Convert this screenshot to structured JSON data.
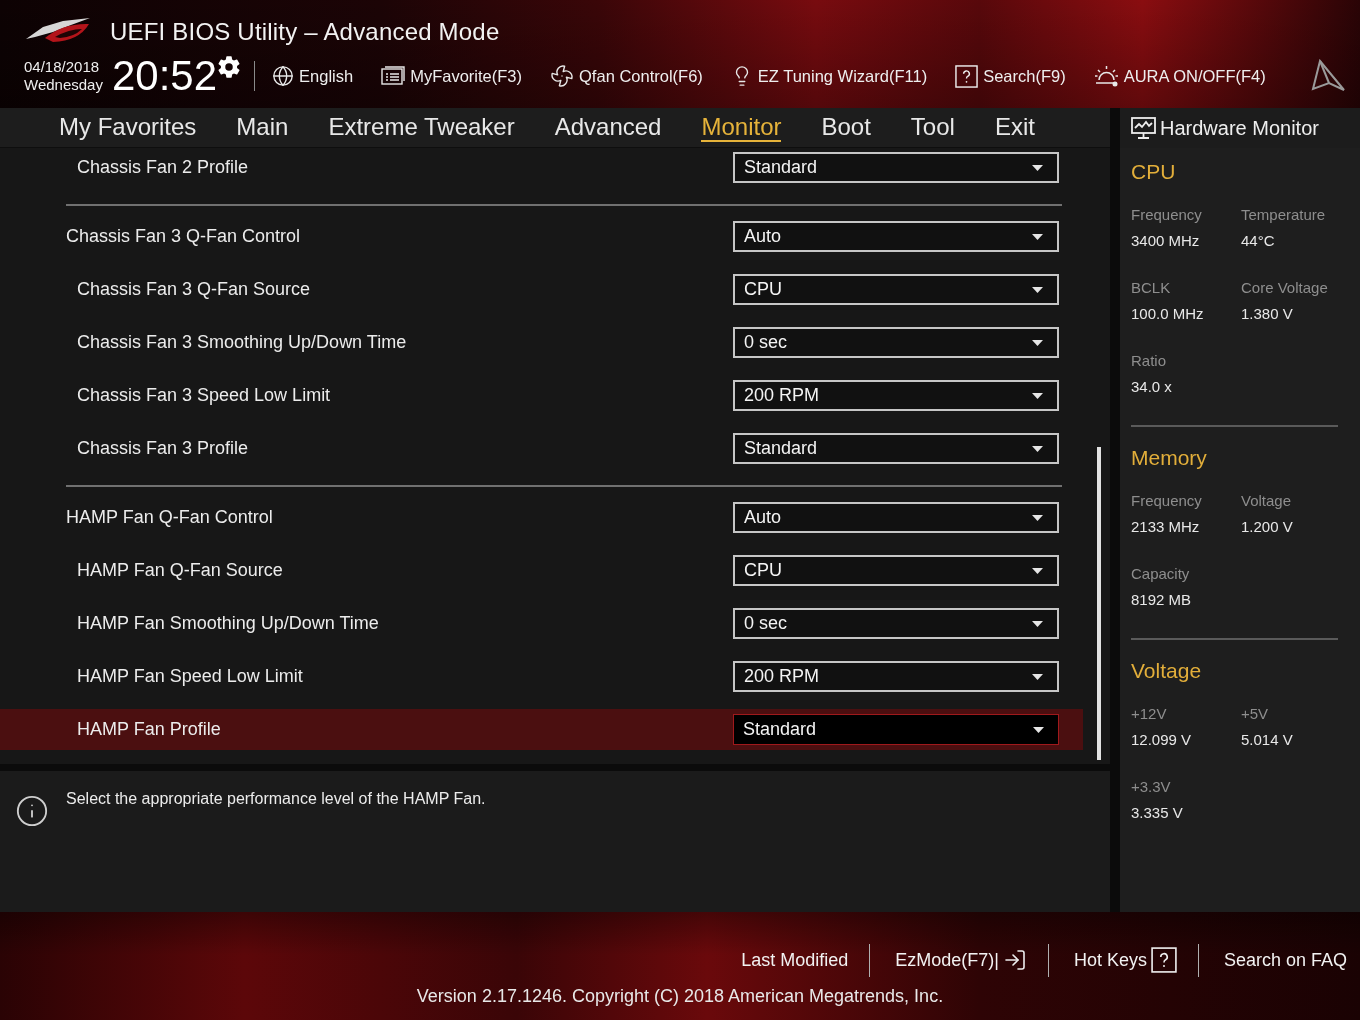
{
  "header": {
    "title": "UEFI BIOS Utility – Advanced Mode",
    "date": "04/18/2018",
    "weekday": "Wednesday",
    "time": "20:52",
    "toolbar": [
      {
        "label": "English",
        "kind": "globe"
      },
      {
        "label": "MyFavorite(F3)",
        "kind": "favorite"
      },
      {
        "label": "Qfan Control(F6)",
        "kind": "fan"
      },
      {
        "label": "EZ Tuning Wizard(F11)",
        "kind": "wizard"
      },
      {
        "label": "Search(F9)",
        "kind": "search"
      },
      {
        "label": "AURA ON/OFF(F4)",
        "kind": "aura"
      }
    ]
  },
  "tabs": [
    {
      "label": "My Favorites",
      "selected": false
    },
    {
      "label": "Main",
      "selected": false
    },
    {
      "label": "Extreme Tweaker",
      "selected": false
    },
    {
      "label": "Advanced",
      "selected": false
    },
    {
      "label": "Monitor",
      "selected": true
    },
    {
      "label": "Boot",
      "selected": false
    },
    {
      "label": "Tool",
      "selected": false
    },
    {
      "label": "Exit",
      "selected": false
    }
  ],
  "settings": [
    {
      "children": [
        {
          "label": "Chassis Fan 2 Profile",
          "value": "Standard",
          "selected": false
        }
      ]
    },
    {
      "label": "Chassis Fan 3 Q-Fan Control",
      "value": "Auto",
      "selected": false,
      "children": [
        {
          "label": "Chassis Fan 3 Q-Fan Source",
          "value": "CPU",
          "selected": false
        },
        {
          "label": "Chassis Fan 3 Smoothing Up/Down Time",
          "value": "0 sec",
          "selected": false
        },
        {
          "label": "Chassis Fan 3 Speed Low Limit",
          "value": "200 RPM",
          "selected": false
        },
        {
          "label": "Chassis Fan 3 Profile",
          "value": "Standard",
          "selected": false
        }
      ]
    },
    {
      "label": "HAMP Fan Q-Fan Control",
      "value": "Auto",
      "selected": false,
      "children": [
        {
          "label": "HAMP Fan Q-Fan Source",
          "value": "CPU",
          "selected": false
        },
        {
          "label": "HAMP Fan Smoothing Up/Down Time",
          "value": "0 sec",
          "selected": false
        },
        {
          "label": "HAMP Fan Speed Low Limit",
          "value": "200 RPM",
          "selected": false
        },
        {
          "label": "HAMP Fan Profile",
          "value": "Standard",
          "selected": true
        }
      ]
    }
  ],
  "help": {
    "text": "Select the appropriate performance level of the HAMP Fan."
  },
  "hardware_monitor": {
    "title": "Hardware Monitor",
    "sections": [
      {
        "title": "CPU",
        "items": [
          {
            "label": "Frequency",
            "value": "3400 MHz"
          },
          {
            "label": "Temperature",
            "value": "44°C"
          },
          {
            "label": "BCLK",
            "value": "100.0 MHz"
          },
          {
            "label": "Core Voltage",
            "value": "1.380 V"
          },
          {
            "label": "Ratio",
            "value": "34.0 x"
          }
        ]
      },
      {
        "title": "Memory",
        "items": [
          {
            "label": "Frequency",
            "value": "2133 MHz"
          },
          {
            "label": "Voltage",
            "value": "1.200 V"
          },
          {
            "label": "Capacity",
            "value": "8192 MB"
          }
        ]
      },
      {
        "title": "Voltage",
        "items": [
          {
            "label": "+12V",
            "value": "12.099 V"
          },
          {
            "label": "+5V",
            "value": "5.014 V"
          },
          {
            "label": "+3.3V",
            "value": "3.335 V"
          }
        ]
      }
    ]
  },
  "footer": {
    "links": [
      {
        "label": "Last Modified",
        "kind": "plain"
      },
      {
        "label": "EzMode(F7)|",
        "kind": "exit"
      },
      {
        "label": "Hot Keys",
        "kind": "help"
      },
      {
        "label": "Search on FAQ",
        "kind": "plain"
      }
    ],
    "version": "Version 2.17.1246. Copyright (C) 2018 American Megatrends, Inc."
  }
}
